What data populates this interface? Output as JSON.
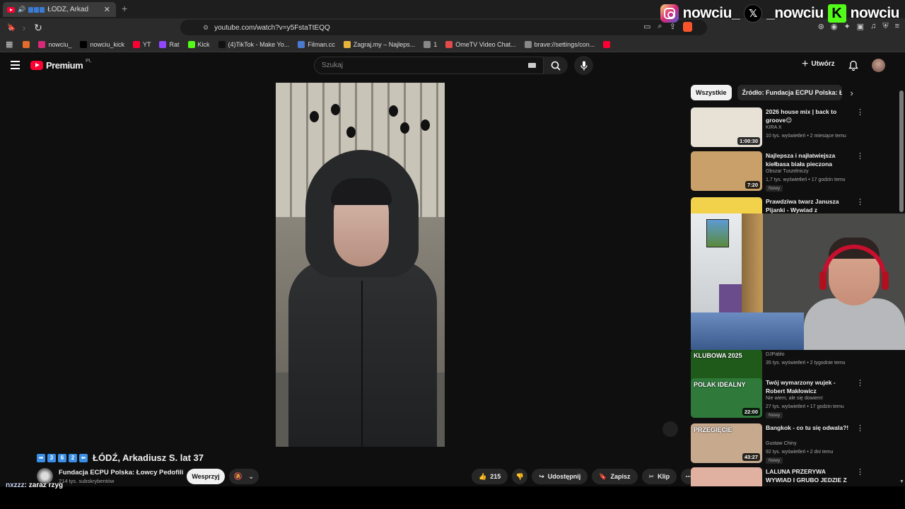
{
  "browser": {
    "tab_title": "ŁÓDŹ, Arkadius",
    "tab_emoji": [
      "3",
      "6",
      "2"
    ],
    "new_tab": "+",
    "url": "youtube.com/watch?v=y5FstaTtEQQ",
    "bookmarks": [
      {
        "label": "",
        "icon": "rss-icon",
        "color": "#e36c2a"
      },
      {
        "label": "nowciu_",
        "icon": "instagram-icon",
        "color": "#d62976"
      },
      {
        "label": "nowciu_kick",
        "icon": "x-icon",
        "color": "#000000"
      },
      {
        "label": "YT",
        "icon": "youtube-icon",
        "color": "#ff0033"
      },
      {
        "label": "Rat",
        "icon": "twitch-icon",
        "color": "#9146ff"
      },
      {
        "label": "Kick",
        "icon": "kick-icon",
        "color": "#53fc18"
      },
      {
        "label": "(4)TikTok - Make Yo...",
        "icon": "tiktok-icon",
        "color": "#111111"
      },
      {
        "label": "Filman.cc",
        "icon": "filman-icon",
        "color": "#4a7bd0"
      },
      {
        "label": "Zagraj.my – Najleps...",
        "icon": "zagraj-icon",
        "color": "#e8b53a"
      },
      {
        "label": "1",
        "icon": "globe-icon",
        "color": "#888888"
      },
      {
        "label": "OmeTV Video Chat...",
        "icon": "ometv-icon",
        "color": "#e34a4a"
      },
      {
        "label": "brave://settings/con...",
        "icon": "globe-icon",
        "color": "#888888"
      },
      {
        "label": "",
        "icon": "youtube-icon",
        "color": "#ff0033"
      }
    ]
  },
  "overlay": {
    "instagram": "nowciu_",
    "x": "_nowciu",
    "kick": "nowciu",
    "chat_user": "nxzzz",
    "chat_msg": ": zaraz rzyg"
  },
  "youtube": {
    "logo": "Premium",
    "logo_region": "PL",
    "search_placeholder": "Szukaj",
    "create_label": "Utwórz"
  },
  "video": {
    "title_nums": [
      "➡",
      "3",
      "6",
      "2",
      "⬅"
    ],
    "title": "ŁÓDŹ, Arkadiusz S. lat 37",
    "channel": "Fundacja ECPU Polska: Łowcy Pedofili",
    "subs": "214 tys. subskrybentów",
    "support_label": "Wesprzyj",
    "likes": "215",
    "share_label": "Udostępnij",
    "save_label": "Zapisz",
    "clip_label": "Klip"
  },
  "sidebar": {
    "chips": [
      "Wszystkie",
      "Źródło: Fundacja ECPU Polska: Łowcy"
    ],
    "recommendations": [
      {
        "title": "2026 house mix | back to groove😊",
        "channel": "KIRA X",
        "meta": "10 tys. wyświetleń • 2 miesiące temu",
        "duration": "1:00:30",
        "badge": "",
        "color": "#e8e2d6"
      },
      {
        "title": "Najlepsza i najłatwiejsza kiełbasa biała pieczona tuszo...",
        "channel": "Obszar Tuszelniczy",
        "meta": "1,7 tys. wyświetleń • 17 godzin temu",
        "duration": "7:20",
        "badge": "Nowy",
        "color": "#c9a06a"
      },
      {
        "title": "Prawdziwa twarz Janusza Pijanki - Wywiad z paszkwilem",
        "channel": "",
        "meta": "",
        "duration": "",
        "badge": "",
        "color": "#f2d24b"
      },
      {
        "title": "",
        "channel": "DJPablo",
        "meta": "35 tys. wyświetleń • 2 tygodnie temu",
        "duration": "38:51",
        "badge": "",
        "color": "#1f5a1a",
        "thumb_text": "KLUBOWA 2025"
      },
      {
        "title": "Twój wymarzony wujek - Robert Makłowicz",
        "channel": "Nie wiem, ale się dowiem!",
        "meta": "27 tys. wyświetleń • 17 godzin temu",
        "duration": "22:00",
        "badge": "Nowy",
        "color": "#2f7a3a",
        "thumb_text": "POLAK IDEALNY"
      },
      {
        "title": "Bangkok - co tu się odwala?!",
        "channel": "Gustaw Chiny",
        "meta": "92 tys. wyświetleń • 2 dni temu",
        "duration": "43:27",
        "badge": "Nowy",
        "color": "#c7a98e",
        "thumb_text": "PRZEGIĘCIE"
      },
      {
        "title": "LALUNA PRZERYWA WYWIAD I GRUBO JEDZIE Z ...",
        "channel": "",
        "meta": "",
        "duration": "",
        "badge": "",
        "color": "#e0b0a0"
      }
    ]
  },
  "colors": {
    "accent": "#ff0033",
    "bg": "#0f0f0f",
    "pill": "#272727"
  }
}
